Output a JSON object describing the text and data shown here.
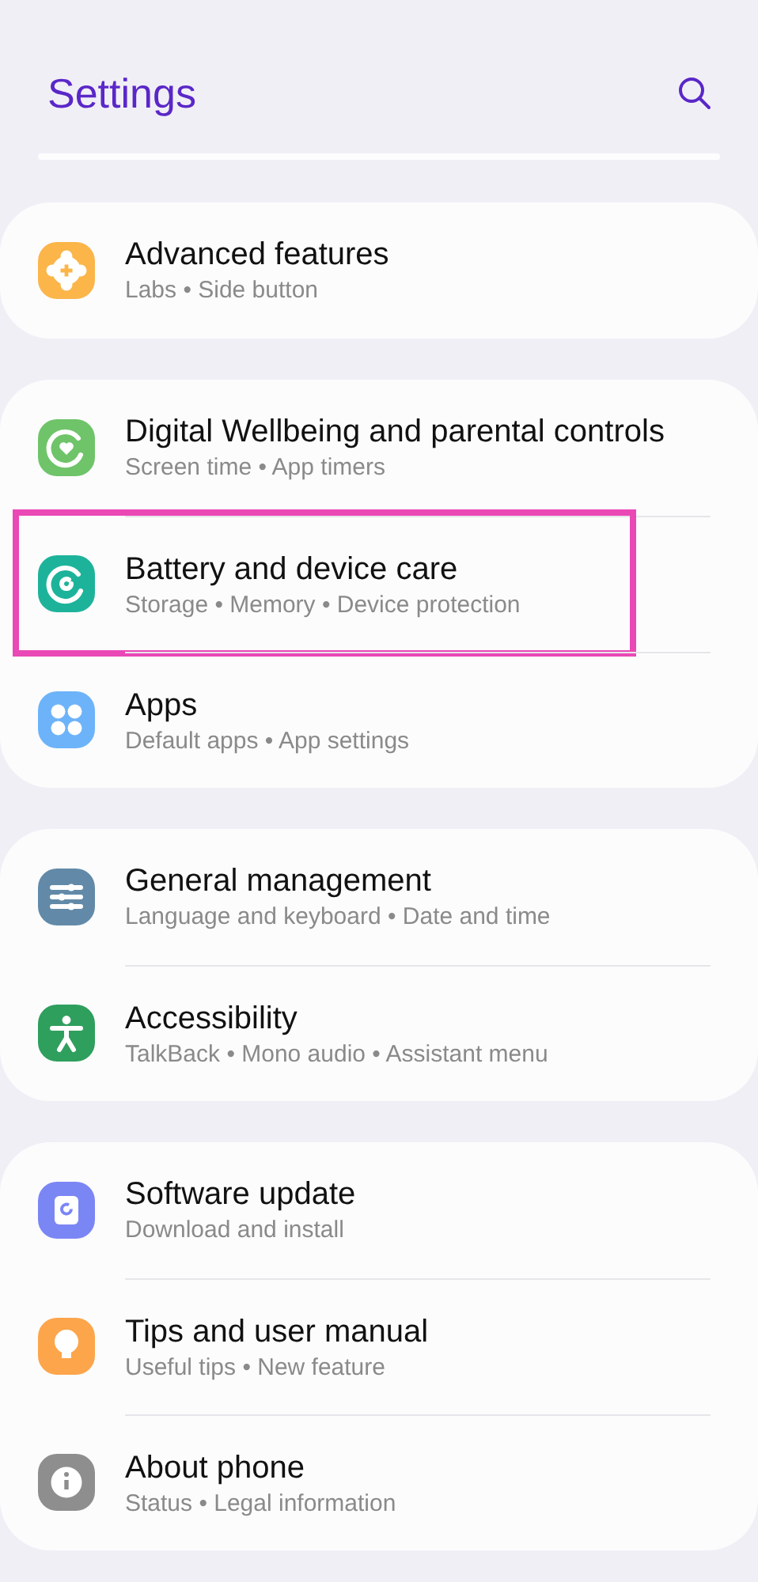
{
  "header": {
    "title": "Settings"
  },
  "groups": [
    {
      "items": [
        {
          "kind": "gear",
          "color": "#fbb549",
          "title": "Advanced features",
          "summary": "Labs • Side button",
          "highlighted": false
        }
      ]
    },
    {
      "items": [
        {
          "kind": "heart-ring",
          "color": "#6fc46a",
          "title": "Digital Wellbeing and parental controls",
          "summary": "Screen time • App timers",
          "highlighted": false
        },
        {
          "kind": "care",
          "color": "#1db39b",
          "title": "Battery and device care",
          "summary": "Storage • Memory • Device protection",
          "highlighted": true
        },
        {
          "kind": "apps",
          "color": "#6db3f9",
          "title": "Apps",
          "summary": "Default apps • App settings",
          "highlighted": false
        }
      ]
    },
    {
      "items": [
        {
          "kind": "sliders",
          "color": "#628aa8",
          "title": "General management",
          "summary": "Language and keyboard • Date and time",
          "highlighted": false
        },
        {
          "kind": "person",
          "color": "#2f9f5d",
          "title": "Accessibility",
          "summary": "TalkBack • Mono audio • Assistant menu",
          "highlighted": false
        }
      ]
    },
    {
      "items": [
        {
          "kind": "update",
          "color": "#7b86f5",
          "title": "Software update",
          "summary": "Download and install",
          "highlighted": false
        },
        {
          "kind": "bulb",
          "color": "#fda54a",
          "title": "Tips and user manual",
          "summary": "Useful tips • New feature",
          "highlighted": false
        },
        {
          "kind": "info",
          "color": "#8e8e8e",
          "title": "About phone",
          "summary": "Status • Legal information",
          "highlighted": false
        }
      ]
    }
  ]
}
